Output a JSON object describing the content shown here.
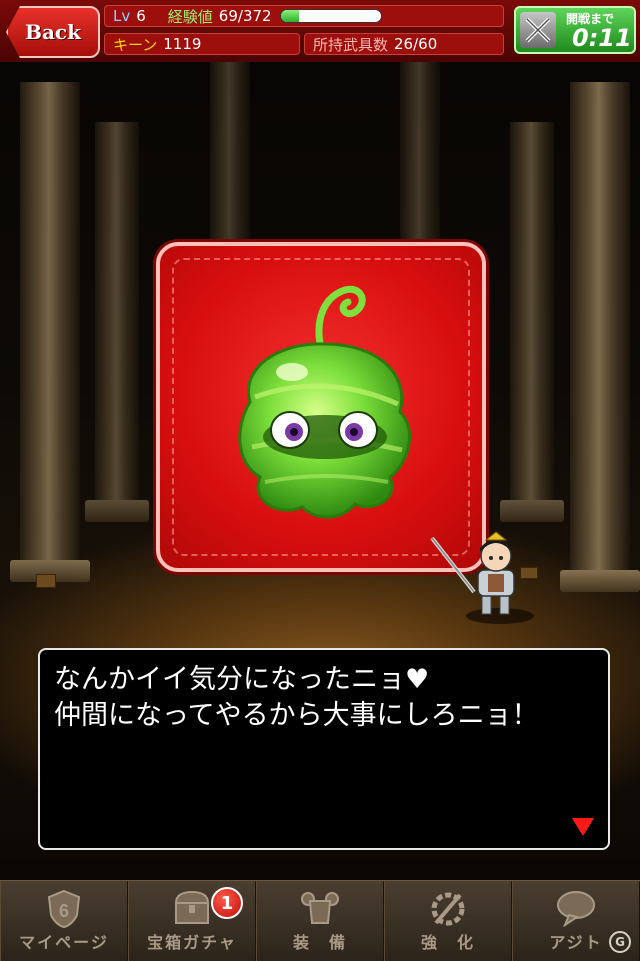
{
  "header": {
    "back_label": "Back",
    "level_label": "Lv",
    "level_value": "6",
    "exp_label": "経験値",
    "exp_value": "69/372",
    "exp_progress": 0.185,
    "currency_label": "キーン",
    "currency_value": "1119",
    "weapons_label": "所持武具数",
    "weapons_value": "26/60",
    "timer_label": "開戦まで",
    "timer_value": "0:11"
  },
  "dialog": {
    "lines": [
      "なんかイイ気分になったニョ♥",
      "仲間になってやるから大事にしろニョ！"
    ]
  },
  "nav": {
    "items": [
      {
        "label": "マイページ",
        "icon": "mypage-shield-icon"
      },
      {
        "label": "宝箱ガチャ",
        "icon": "treasure-chest-icon",
        "badge": "1"
      },
      {
        "label": "装　備",
        "icon": "armor-icon"
      },
      {
        "label": "強　化",
        "icon": "enhance-icon"
      },
      {
        "label": "アジト",
        "icon": "speech-bubble-icon"
      }
    ]
  },
  "colors": {
    "card_red": "#d80e0e",
    "slime_green": "#6fd63a",
    "dialog_arrow": "#ff1a1a",
    "timer_green": "#3ab836"
  }
}
